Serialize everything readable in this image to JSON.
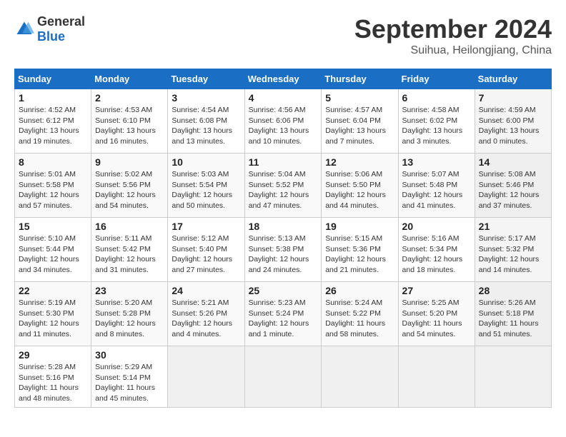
{
  "header": {
    "logo_general": "General",
    "logo_blue": "Blue",
    "month": "September 2024",
    "location": "Suihua, Heilongjiang, China"
  },
  "weekdays": [
    "Sunday",
    "Monday",
    "Tuesday",
    "Wednesday",
    "Thursday",
    "Friday",
    "Saturday"
  ],
  "weeks": [
    [
      {
        "day": "1",
        "info": "Sunrise: 4:52 AM\nSunset: 6:12 PM\nDaylight: 13 hours\nand 19 minutes."
      },
      {
        "day": "2",
        "info": "Sunrise: 4:53 AM\nSunset: 6:10 PM\nDaylight: 13 hours\nand 16 minutes."
      },
      {
        "day": "3",
        "info": "Sunrise: 4:54 AM\nSunset: 6:08 PM\nDaylight: 13 hours\nand 13 minutes."
      },
      {
        "day": "4",
        "info": "Sunrise: 4:56 AM\nSunset: 6:06 PM\nDaylight: 13 hours\nand 10 minutes."
      },
      {
        "day": "5",
        "info": "Sunrise: 4:57 AM\nSunset: 6:04 PM\nDaylight: 13 hours\nand 7 minutes."
      },
      {
        "day": "6",
        "info": "Sunrise: 4:58 AM\nSunset: 6:02 PM\nDaylight: 13 hours\nand 3 minutes."
      },
      {
        "day": "7",
        "info": "Sunrise: 4:59 AM\nSunset: 6:00 PM\nDaylight: 13 hours\nand 0 minutes."
      }
    ],
    [
      {
        "day": "8",
        "info": "Sunrise: 5:01 AM\nSunset: 5:58 PM\nDaylight: 12 hours\nand 57 minutes."
      },
      {
        "day": "9",
        "info": "Sunrise: 5:02 AM\nSunset: 5:56 PM\nDaylight: 12 hours\nand 54 minutes."
      },
      {
        "day": "10",
        "info": "Sunrise: 5:03 AM\nSunset: 5:54 PM\nDaylight: 12 hours\nand 50 minutes."
      },
      {
        "day": "11",
        "info": "Sunrise: 5:04 AM\nSunset: 5:52 PM\nDaylight: 12 hours\nand 47 minutes."
      },
      {
        "day": "12",
        "info": "Sunrise: 5:06 AM\nSunset: 5:50 PM\nDaylight: 12 hours\nand 44 minutes."
      },
      {
        "day": "13",
        "info": "Sunrise: 5:07 AM\nSunset: 5:48 PM\nDaylight: 12 hours\nand 41 minutes."
      },
      {
        "day": "14",
        "info": "Sunrise: 5:08 AM\nSunset: 5:46 PM\nDaylight: 12 hours\nand 37 minutes."
      }
    ],
    [
      {
        "day": "15",
        "info": "Sunrise: 5:10 AM\nSunset: 5:44 PM\nDaylight: 12 hours\nand 34 minutes."
      },
      {
        "day": "16",
        "info": "Sunrise: 5:11 AM\nSunset: 5:42 PM\nDaylight: 12 hours\nand 31 minutes."
      },
      {
        "day": "17",
        "info": "Sunrise: 5:12 AM\nSunset: 5:40 PM\nDaylight: 12 hours\nand 27 minutes."
      },
      {
        "day": "18",
        "info": "Sunrise: 5:13 AM\nSunset: 5:38 PM\nDaylight: 12 hours\nand 24 minutes."
      },
      {
        "day": "19",
        "info": "Sunrise: 5:15 AM\nSunset: 5:36 PM\nDaylight: 12 hours\nand 21 minutes."
      },
      {
        "day": "20",
        "info": "Sunrise: 5:16 AM\nSunset: 5:34 PM\nDaylight: 12 hours\nand 18 minutes."
      },
      {
        "day": "21",
        "info": "Sunrise: 5:17 AM\nSunset: 5:32 PM\nDaylight: 12 hours\nand 14 minutes."
      }
    ],
    [
      {
        "day": "22",
        "info": "Sunrise: 5:19 AM\nSunset: 5:30 PM\nDaylight: 12 hours\nand 11 minutes."
      },
      {
        "day": "23",
        "info": "Sunrise: 5:20 AM\nSunset: 5:28 PM\nDaylight: 12 hours\nand 8 minutes."
      },
      {
        "day": "24",
        "info": "Sunrise: 5:21 AM\nSunset: 5:26 PM\nDaylight: 12 hours\nand 4 minutes."
      },
      {
        "day": "25",
        "info": "Sunrise: 5:23 AM\nSunset: 5:24 PM\nDaylight: 12 hours\nand 1 minute."
      },
      {
        "day": "26",
        "info": "Sunrise: 5:24 AM\nSunset: 5:22 PM\nDaylight: 11 hours\nand 58 minutes."
      },
      {
        "day": "27",
        "info": "Sunrise: 5:25 AM\nSunset: 5:20 PM\nDaylight: 11 hours\nand 54 minutes."
      },
      {
        "day": "28",
        "info": "Sunrise: 5:26 AM\nSunset: 5:18 PM\nDaylight: 11 hours\nand 51 minutes."
      }
    ],
    [
      {
        "day": "29",
        "info": "Sunrise: 5:28 AM\nSunset: 5:16 PM\nDaylight: 11 hours\nand 48 minutes."
      },
      {
        "day": "30",
        "info": "Sunrise: 5:29 AM\nSunset: 5:14 PM\nDaylight: 11 hours\nand 45 minutes."
      },
      null,
      null,
      null,
      null,
      null
    ]
  ]
}
